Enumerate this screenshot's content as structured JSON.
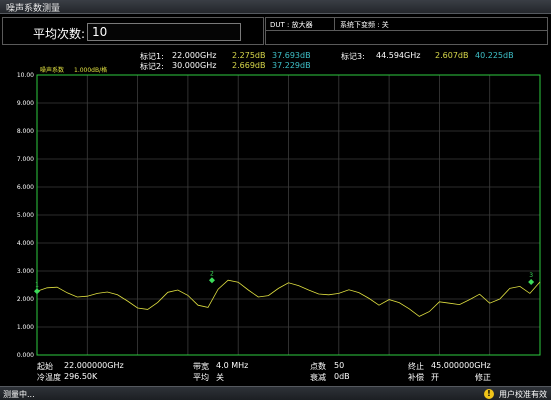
{
  "window": {
    "title": "噪声系数测量"
  },
  "averaging": {
    "label": "平均次数:",
    "value": "10"
  },
  "status_top": {
    "dut": "DUT : 放大器",
    "downconv": "系统下变频 : 关"
  },
  "markers": [
    {
      "label": "标记1:",
      "freq": "22.000GHz",
      "nf": "2.275dB",
      "gain": "37.693dB"
    },
    {
      "label": "标记2:",
      "freq": "30.000GHz",
      "nf": "2.669dB",
      "gain": "37.229dB"
    },
    {
      "label": "标记3:",
      "freq": "44.594GHz",
      "nf": "2.607dB",
      "gain": "40.225dB"
    }
  ],
  "plot_header": {
    "trace_name": "噪声系数",
    "scale": "1.000dB/格"
  },
  "y_ticks": [
    "10.00",
    "9.000",
    "8.000",
    "7.000",
    "6.000",
    "5.000",
    "4.000",
    "3.000",
    "2.000",
    "1.000",
    "0.000"
  ],
  "marker_labels": [
    "1",
    "2",
    "3"
  ],
  "settings": {
    "start_label": "起始",
    "start_value": "22.000000GHz",
    "bw_label": "带宽",
    "bw_value": "4.0  MHz",
    "points_label": "点数",
    "points_value": "50",
    "stop_label": "终止",
    "stop_value": "45.000000GHz",
    "tcold_label": "冷温度",
    "tcold_value": "296.50K",
    "avg_label": "平均",
    "avg_value": "关",
    "atten_label": "衰减",
    "atten_value": "0dB",
    "comp_label": "补偿",
    "comp_value": "开",
    "correct_label": "修正"
  },
  "statusbar": {
    "left": "测量中...",
    "right": "用户校准有效"
  },
  "colors": {
    "grid": "#3c3c3c",
    "border": "#2ecc40",
    "trace": "#e0e040",
    "marker": "#3cdc5a"
  },
  "chart_data": {
    "type": "line",
    "title": "噪声系数",
    "xlabel": "",
    "ylabel": "",
    "xlim": [
      22.0,
      45.0
    ],
    "ylim": [
      0,
      10
    ],
    "x_unit": "GHz",
    "series": [
      {
        "values": [
          2.28,
          2.4,
          2.42,
          2.22,
          2.07,
          2.1,
          2.2,
          2.25,
          2.15,
          1.93,
          1.68,
          1.63,
          1.88,
          2.24,
          2.32,
          2.13,
          1.78,
          1.7,
          2.35,
          2.67,
          2.6,
          2.32,
          2.07,
          2.12,
          2.38,
          2.58,
          2.48,
          2.32,
          2.18,
          2.15,
          2.2,
          2.33,
          2.23,
          2.02,
          1.78,
          1.98,
          1.87,
          1.65,
          1.38,
          1.55,
          1.9,
          1.85,
          1.8,
          1.98,
          2.17,
          1.85,
          2.0,
          2.38,
          2.45,
          2.2,
          2.61
        ]
      }
    ],
    "markers": [
      {
        "id": "1",
        "x": 22.0,
        "y": 2.275
      },
      {
        "id": "2",
        "x": 30.0,
        "y": 2.669
      },
      {
        "id": "3",
        "x": 44.594,
        "y": 2.607
      }
    ],
    "grid": true
  }
}
